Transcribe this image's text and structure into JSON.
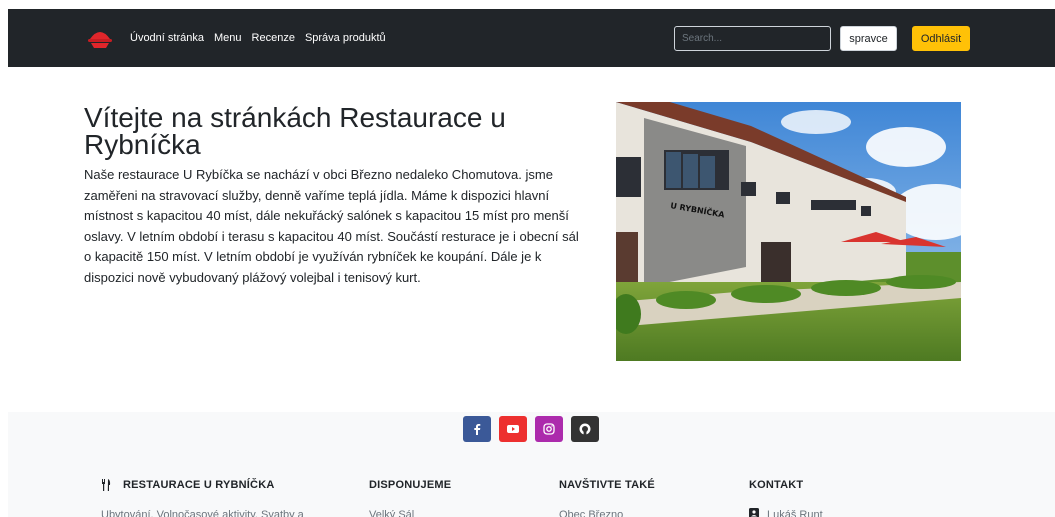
{
  "navbar": {
    "links": [
      "Úvodní stránka",
      "Menu",
      "Recenze",
      "Správa produktů"
    ],
    "search_placeholder": "Search...",
    "user_button": "spravce",
    "logout_button": "Odhlásit"
  },
  "hero": {
    "title": "Vítejte na stránkách Restaurace u Rybníčka",
    "text": "Naše restaurace U Rybíčka se nachází v obci Březno nedaleko Chomutova. jsme zaměřeni na stravovací služby, denně vaříme teplá jídla. Máme k dispozici hlavní místnost s kapacitou 40 míst, dále nekuřácký salónek s kapacitou 15 míst pro menší oslavy. V letním období i terasu s kapacitou 40 míst. Součástí resturace je i obecní sál o kapacitě 150 míst. V letním období je využíván rybníček ke koupání. Dále je k dispozici nově vybudovaný plážový volejbal i tenisový kurt.",
    "photo_sign": "U RYBNÍČKA"
  },
  "footer": {
    "social": [
      {
        "icon": "facebook-icon",
        "color": "#3b5998"
      },
      {
        "icon": "youtube-icon",
        "color": "#ed302f"
      },
      {
        "icon": "instagram-icon",
        "color": "#ac2bac"
      },
      {
        "icon": "github-icon",
        "color": "#333333"
      }
    ],
    "columns": [
      {
        "title": "RESTAURACE U RYBNÍČKA",
        "item": "Ubytování, Volnočasové aktivity, Svatby a"
      },
      {
        "title": "DISPONUJEME",
        "item": "Velký Sál"
      },
      {
        "title": "NAVŠTIVTE TAKÉ",
        "item": "Obec Březno"
      },
      {
        "title": "KONTAKT",
        "item": "Lukáš Runt"
      }
    ]
  }
}
